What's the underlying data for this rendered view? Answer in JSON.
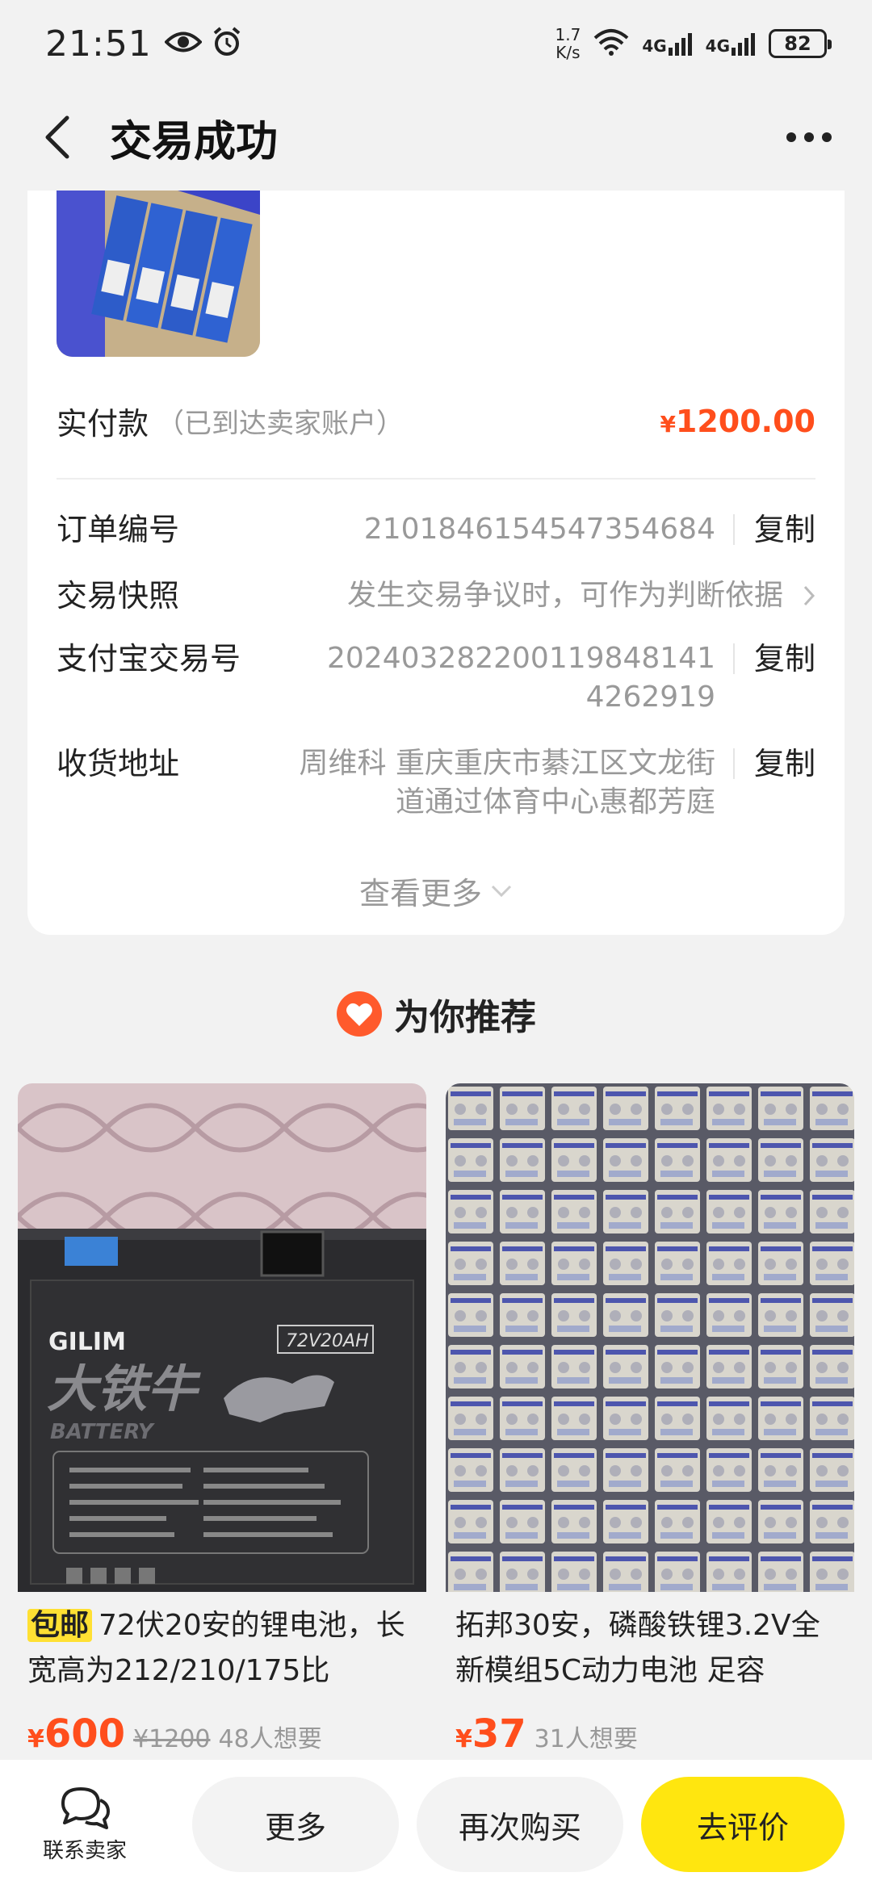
{
  "status_bar": {
    "time": "21:51",
    "net_speed_top": "1.7",
    "net_speed_bottom": "K/s",
    "signal1_label": "4G",
    "signal2_label": "4G",
    "battery": "82"
  },
  "nav": {
    "title": "交易成功"
  },
  "order": {
    "paid_label": "实付款",
    "paid_note": "（已到达卖家账户）",
    "paid_currency": "¥",
    "paid_amount": "1200.00",
    "rows": [
      {
        "label": "订单编号",
        "value": "2101846154547354684",
        "action": "复制"
      },
      {
        "label": "交易快照",
        "value": "发生交易争议时，可作为判断依据"
      },
      {
        "label": "支付宝交易号",
        "value_line1": "20240328220011984814​1",
        "value_line2": "4262919",
        "action": "复制"
      },
      {
        "label": "收货地址",
        "value_line1": "周维科  重庆重庆市綦江区文龙街",
        "value_line2": "道通过体育中心惠都芳庭",
        "action": "复制"
      }
    ],
    "see_more": "查看更多"
  },
  "recommend": {
    "title": "为你推荐",
    "items": [
      {
        "tag": "包邮",
        "name": "72伏20安的锂电池，长宽高为212/210/175比",
        "currency": "¥",
        "price": "600",
        "orig_price": "¥1200",
        "want": "48人想要",
        "img_text_brand": "GILIM",
        "img_text_model": "72V20AH",
        "img_text_title": "大铁牛",
        "img_text_sub": "BATTERY"
      },
      {
        "name": "拓邦30安，磷酸铁锂3.2V全新模组5C动力电池  足容",
        "currency": "¥",
        "price": "37",
        "want": "31人想要"
      }
    ]
  },
  "bottom": {
    "contact_label": "联系卖家",
    "more": "更多",
    "rebuy": "再次购买",
    "review": "去评价"
  },
  "colors": {
    "accent_price": "#ff4e1c",
    "accent_yellow": "#ffe60f"
  }
}
